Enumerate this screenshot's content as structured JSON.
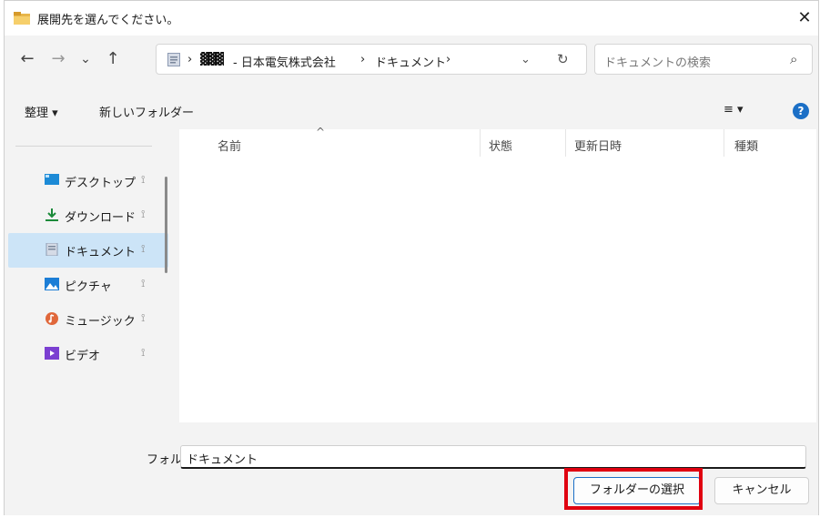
{
  "window": {
    "title": "展開先を選んでください。",
    "close_glyph": "✕"
  },
  "nav": {
    "back": "←",
    "forward": "→",
    "recent": "⌄",
    "up": "↑",
    "breadcrumb": {
      "separator": "›",
      "redacted_prefix": "▓▓▓",
      "company": "- 日本電気株式会社",
      "folder": "ドキュメント"
    },
    "dropdown": "⌄",
    "refresh": "↻",
    "search_placeholder": "ドキュメントの検索",
    "search_icon": "⌕"
  },
  "toolbar": {
    "organize": "整理 ▾",
    "new_folder": "新しいフォルダー",
    "view": "≡ ▾",
    "help": "?"
  },
  "sidebar": {
    "items": [
      {
        "label": "デスクトップ",
        "icon": "desktop-icon",
        "pin": "⟟"
      },
      {
        "label": "ダウンロード",
        "icon": "download-icon",
        "pin": "⟟"
      },
      {
        "label": "ドキュメント",
        "icon": "documents-icon",
        "pin": "⟟",
        "selected": true
      },
      {
        "label": "ピクチャ",
        "icon": "pictures-icon",
        "pin": "⟟"
      },
      {
        "label": "ミュージック",
        "icon": "music-icon",
        "pin": "⟟"
      },
      {
        "label": "ビデオ",
        "icon": "videos-icon",
        "pin": "⟟"
      }
    ]
  },
  "columns": {
    "name": "名前",
    "status": "状態",
    "modified": "更新日時",
    "type": "種類",
    "sort_glyph": "^"
  },
  "bottom": {
    "folder_label": "フォルダー:",
    "folder_value": "ドキュメント",
    "select_button": "フォルダーの選択",
    "cancel_button": "キャンセル"
  },
  "colors": {
    "accent": "#1b6fc6",
    "selection": "#cce4f7",
    "highlight_box": "#e00010"
  }
}
